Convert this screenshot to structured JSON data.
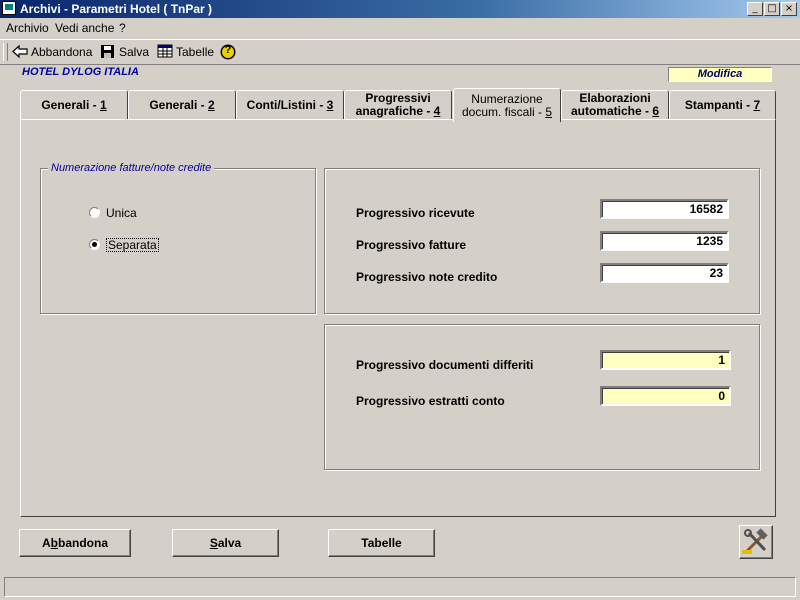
{
  "window": {
    "title": "Archivi - Parametri Hotel ( TnPar )",
    "controls": {
      "minimize": "_",
      "maximize": "□",
      "close": "×"
    }
  },
  "menu": {
    "items": [
      "Archivio",
      "Vedi anche",
      "?"
    ]
  },
  "toolbar": {
    "abbandona_label": "Abbandona",
    "salva_label": "Salva",
    "tabelle_label": "Tabelle",
    "help_symbol": "?"
  },
  "header": {
    "hotel_name": "HOTEL DYLOG ITALIA",
    "mode": "Modifica"
  },
  "tabs": [
    {
      "line1": "Generali - ",
      "key": "1"
    },
    {
      "line1": "Generali - ",
      "key": "2"
    },
    {
      "line1": "Conti/Listini - ",
      "key": "3"
    },
    {
      "line1": "Progressivi",
      "line2": "anagrafiche - ",
      "key": "4"
    },
    {
      "line1": "Numerazione",
      "line2": "docum. fiscali - ",
      "key": "5",
      "active": true
    },
    {
      "line1": "Elaborazioni",
      "line2": "automatiche - ",
      "key": "6"
    },
    {
      "line1": "Stampanti - ",
      "key": "7"
    }
  ],
  "numerazione": {
    "group_label": "Numerazione fatture/note credite",
    "options": [
      {
        "label": "Unica",
        "selected": false
      },
      {
        "label": "Separata",
        "selected": true
      }
    ]
  },
  "progressivi": {
    "ricevute_label": "Progressivo ricevute",
    "ricevute_value": "16582",
    "fatture_label": "Progressivo fatture",
    "fatture_value": "1235",
    "note_credito_label": "Progressivo note credito",
    "note_credito_value": "23"
  },
  "altri": {
    "differiti_label": "Progressivo documenti differiti",
    "differiti_value": "1",
    "estratti_label": "Progressivo estratti conto",
    "estratti_value": "0"
  },
  "buttons": {
    "abbandona_pre": "A",
    "abbandona_key": "b",
    "abbandona_post": "bandona",
    "salva_key": "S",
    "salva_post": "alva",
    "tabelle_label": "Tabelle"
  },
  "colors": {
    "accent_yellow": "#ffffc0",
    "title_blue": "#0a246a",
    "group_text": "#0000a0"
  }
}
